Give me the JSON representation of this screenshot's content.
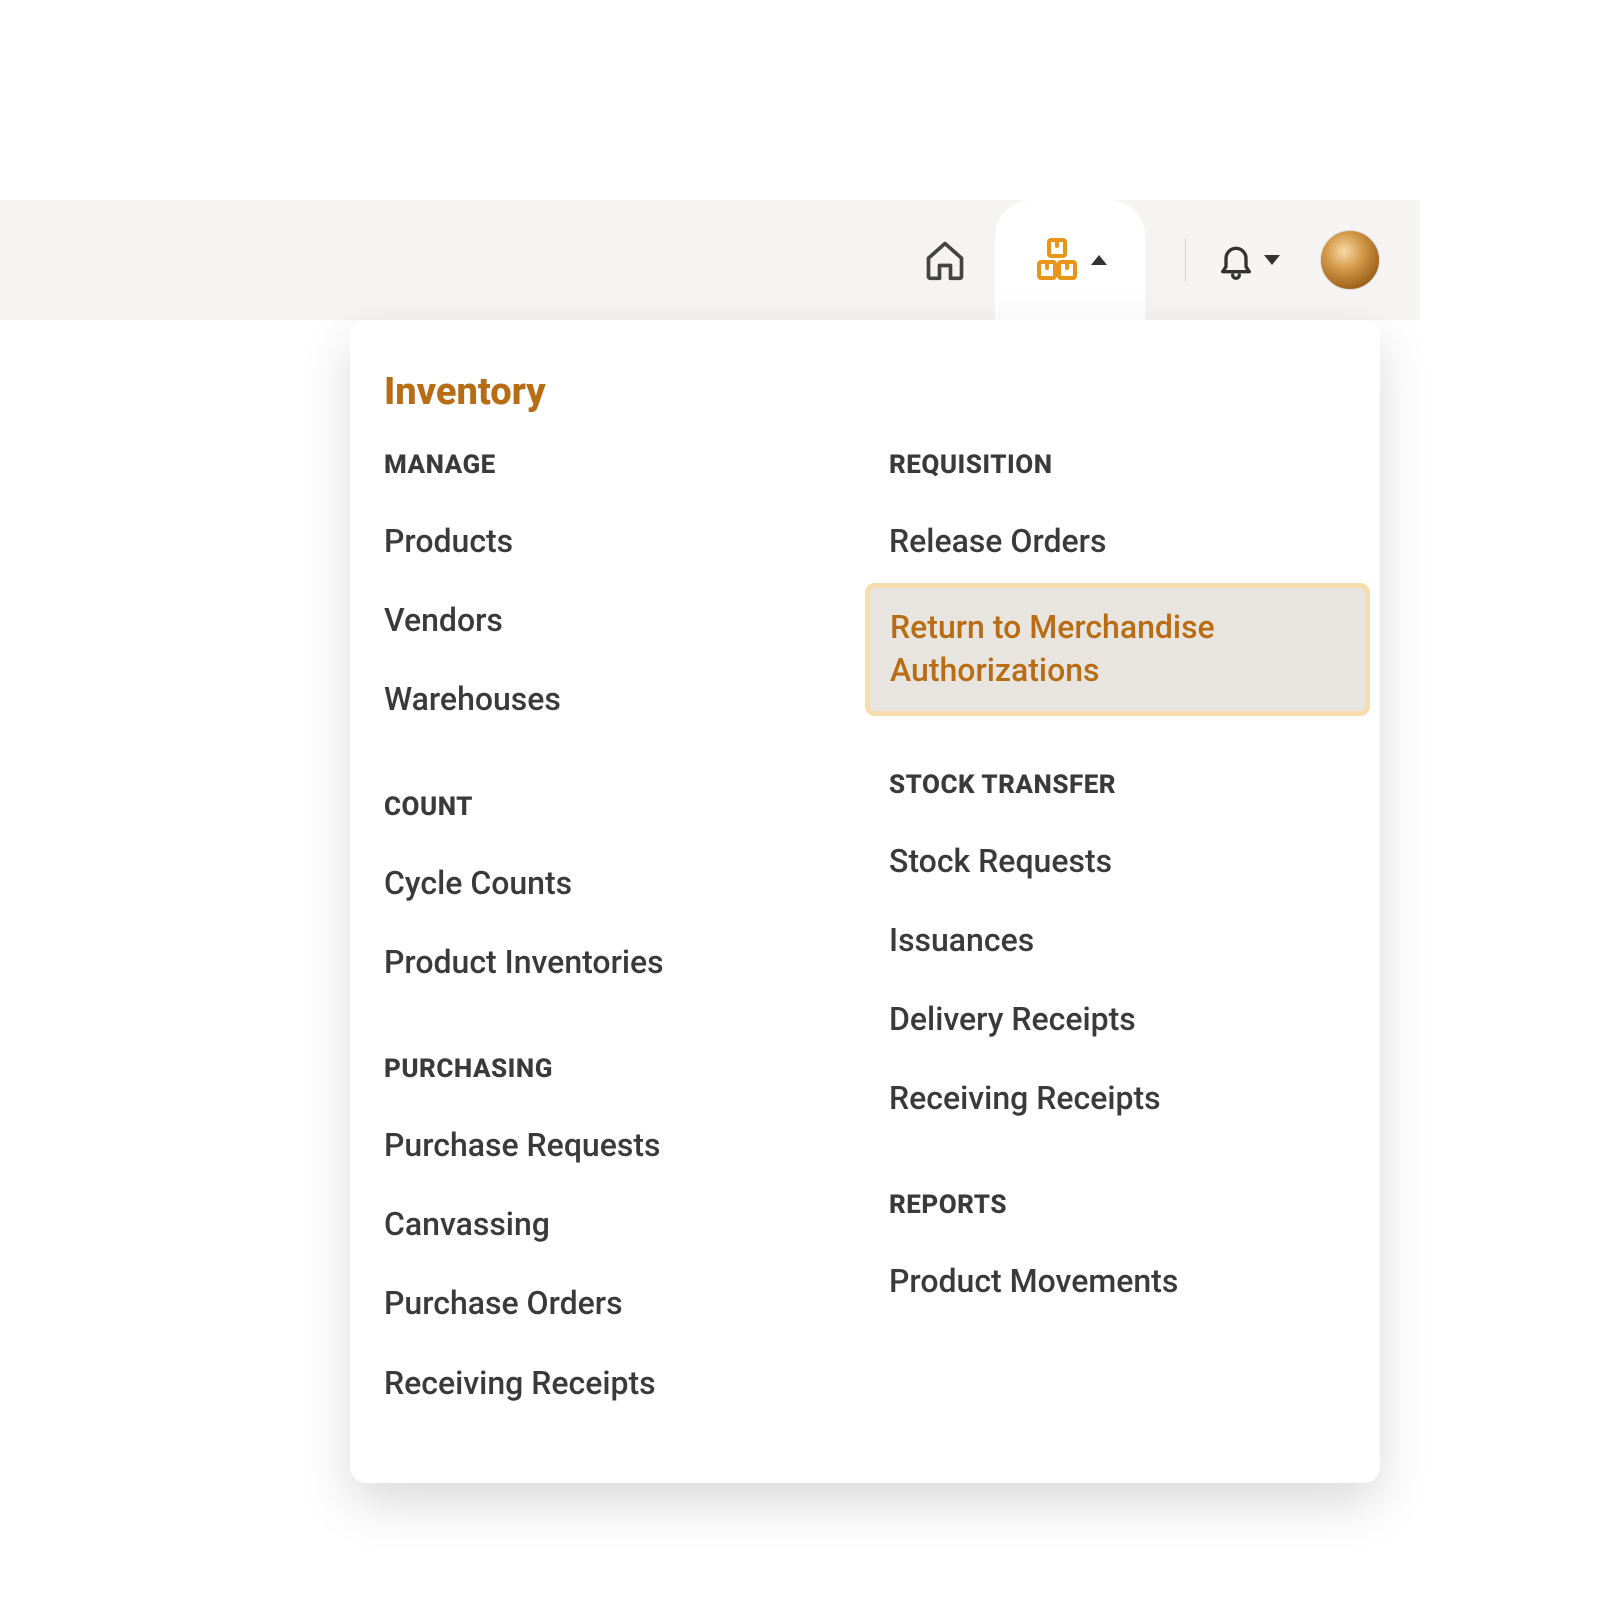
{
  "colors": {
    "accent": "#b86c14",
    "highlight_bg": "#e8e5e0",
    "highlight_border": "#f7dcad",
    "text": "#3a3a3a",
    "topbar_bg": "#f5f4f2"
  },
  "topbar": {
    "home_icon": "home-icon",
    "inventory_icon": "boxes-icon",
    "notification_icon": "bell-icon",
    "avatar": "user-avatar"
  },
  "dropdown": {
    "title": "Inventory",
    "left": [
      {
        "header": "MANAGE",
        "items": [
          "Products",
          "Vendors",
          "Warehouses"
        ]
      },
      {
        "header": "COUNT",
        "items": [
          "Cycle Counts",
          "Product Inventories"
        ]
      },
      {
        "header": "PURCHASING",
        "items": [
          "Purchase Requests",
          "Canvassing",
          "Purchase Orders",
          "Receiving Receipts"
        ]
      }
    ],
    "right": [
      {
        "header": "REQUISITION",
        "items": [
          "Release Orders",
          "Return to Merchandise Authorizations"
        ],
        "highlight_index": 1
      },
      {
        "header": "STOCK TRANSFER",
        "items": [
          "Stock Requests",
          "Issuances",
          "Delivery Receipts",
          "Receiving Receipts"
        ]
      },
      {
        "header": "REPORTS",
        "items": [
          "Product Movements"
        ]
      }
    ]
  }
}
